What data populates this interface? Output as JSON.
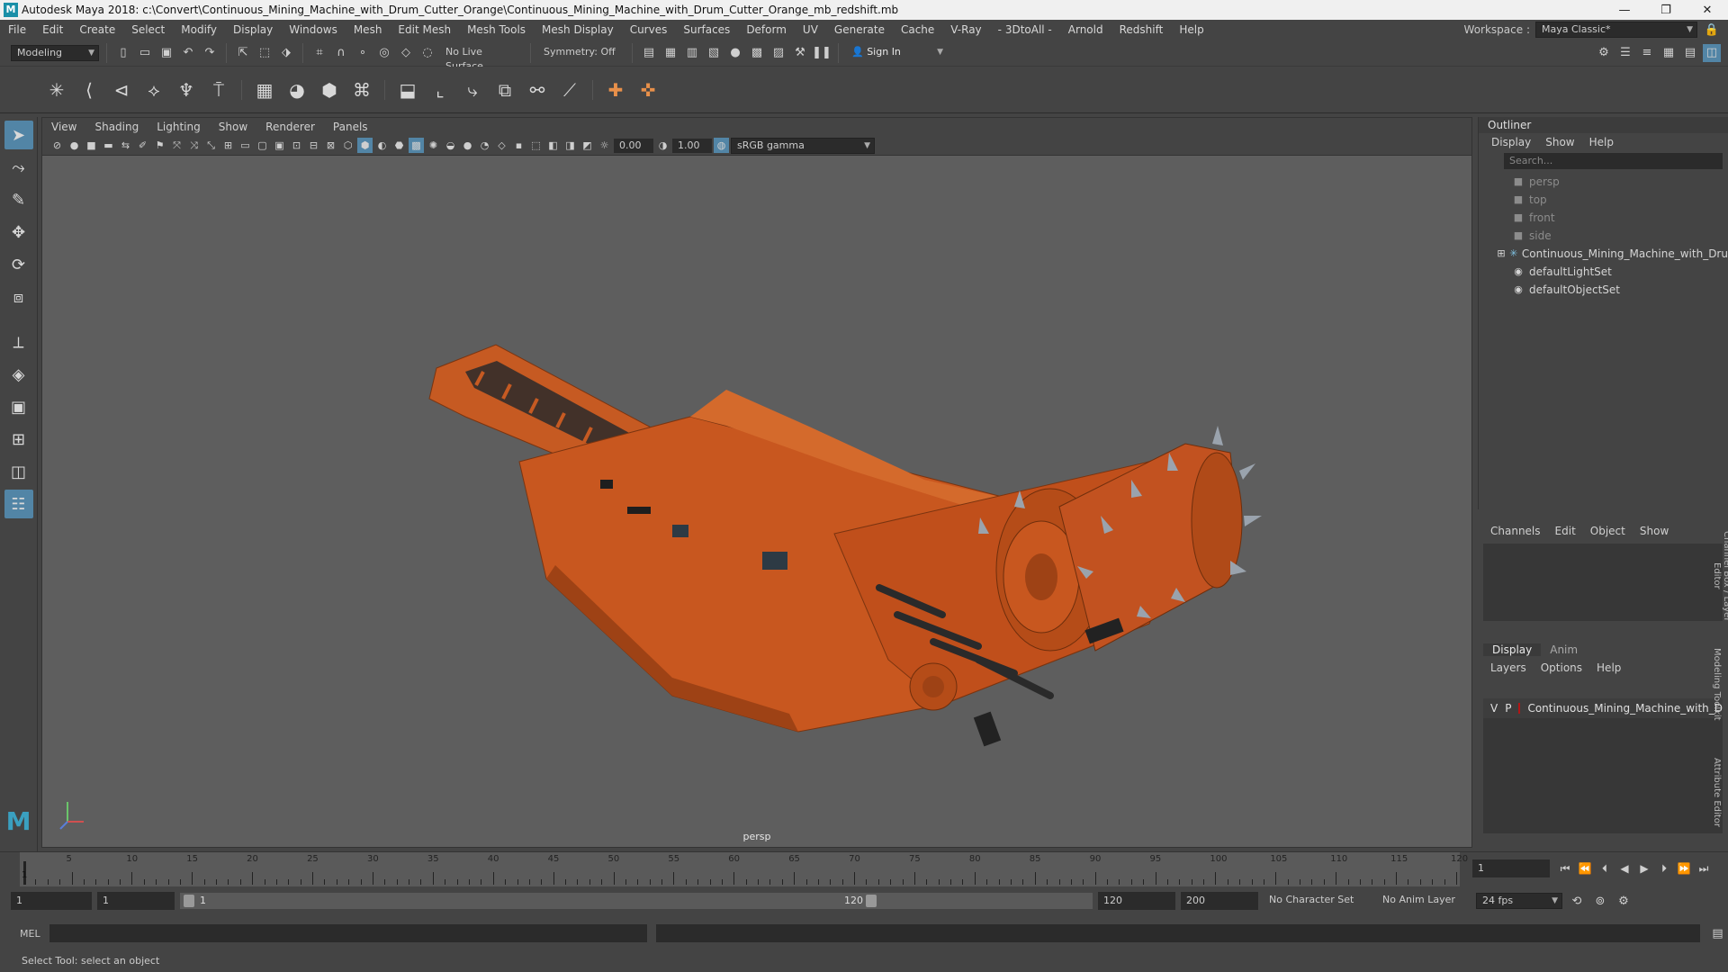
{
  "window": {
    "title": "Autodesk Maya 2018: c:\\Convert\\Continuous_Mining_Machine_with_Drum_Cutter_Orange\\Continuous_Mining_Machine_with_Drum_Cutter_Orange_mb_redshift.mb",
    "logo_letter": "M",
    "minimize": "—",
    "maximize": "❐",
    "close": "✕"
  },
  "menubar": {
    "items": [
      "File",
      "Edit",
      "Create",
      "Select",
      "Modify",
      "Display",
      "Windows",
      "Mesh",
      "Edit Mesh",
      "Mesh Tools",
      "Mesh Display",
      "Curves",
      "Surfaces",
      "Deform",
      "UV",
      "Generate",
      "Cache",
      "V-Ray",
      "- 3DtoAll -",
      "Arnold",
      "Redshift",
      "Help"
    ],
    "workspace_label": "Workspace :",
    "workspace_value": "Maya Classic*"
  },
  "statusline": {
    "mode": "Modeling",
    "live_surface": "No Live Surface",
    "symmetry": "Symmetry: Off",
    "sign_in": "Sign In"
  },
  "viewport": {
    "menu": [
      "View",
      "Shading",
      "Lighting",
      "Show",
      "Renderer",
      "Panels"
    ],
    "exposure": "0.00",
    "gamma": "1.00",
    "color_space": "sRGB gamma",
    "camera": "persp",
    "model_color": "#c8571f"
  },
  "outliner": {
    "title": "Outliner",
    "menu": [
      "Display",
      "Show",
      "Help"
    ],
    "search_placeholder": "Search...",
    "items": [
      {
        "label": "persp",
        "type": "camera"
      },
      {
        "label": "top",
        "type": "camera"
      },
      {
        "label": "front",
        "type": "camera"
      },
      {
        "label": "side",
        "type": "camera"
      },
      {
        "label": "Continuous_Mining_Machine_with_Dru",
        "type": "group"
      },
      {
        "label": "defaultLightSet",
        "type": "set"
      },
      {
        "label": "defaultObjectSet",
        "type": "set"
      }
    ]
  },
  "channelbox": {
    "menu": [
      "Channels",
      "Edit",
      "Object",
      "Show"
    ]
  },
  "layereditor": {
    "tabs": [
      "Display",
      "Anim"
    ],
    "menu": [
      "Layers",
      "Options",
      "Help"
    ],
    "layer": {
      "v": "V",
      "p": "P",
      "name": "Continuous_Mining_Machine_with_D",
      "color": "#b01515"
    }
  },
  "sidetabs": [
    "Channel Box / Layer Editor",
    "Modeling Toolkit",
    "Attribute Editor"
  ],
  "timeline": {
    "ticks": [
      5,
      10,
      15,
      20,
      25,
      30,
      35,
      40,
      45,
      50,
      55,
      60,
      65,
      70,
      75,
      80,
      85,
      90,
      95,
      100,
      105,
      110,
      115,
      120
    ],
    "current_frame": "1",
    "current_frame_field": "1"
  },
  "range": {
    "start": "1",
    "start2": "1",
    "range_start": "1",
    "range_end": "120",
    "end": "120",
    "end2": "200",
    "character_set": "No Character Set",
    "anim_layer": "No Anim Layer",
    "fps": "24 fps"
  },
  "cmdline": {
    "label": "MEL"
  },
  "helpline": {
    "text": "Select Tool: select an object"
  }
}
